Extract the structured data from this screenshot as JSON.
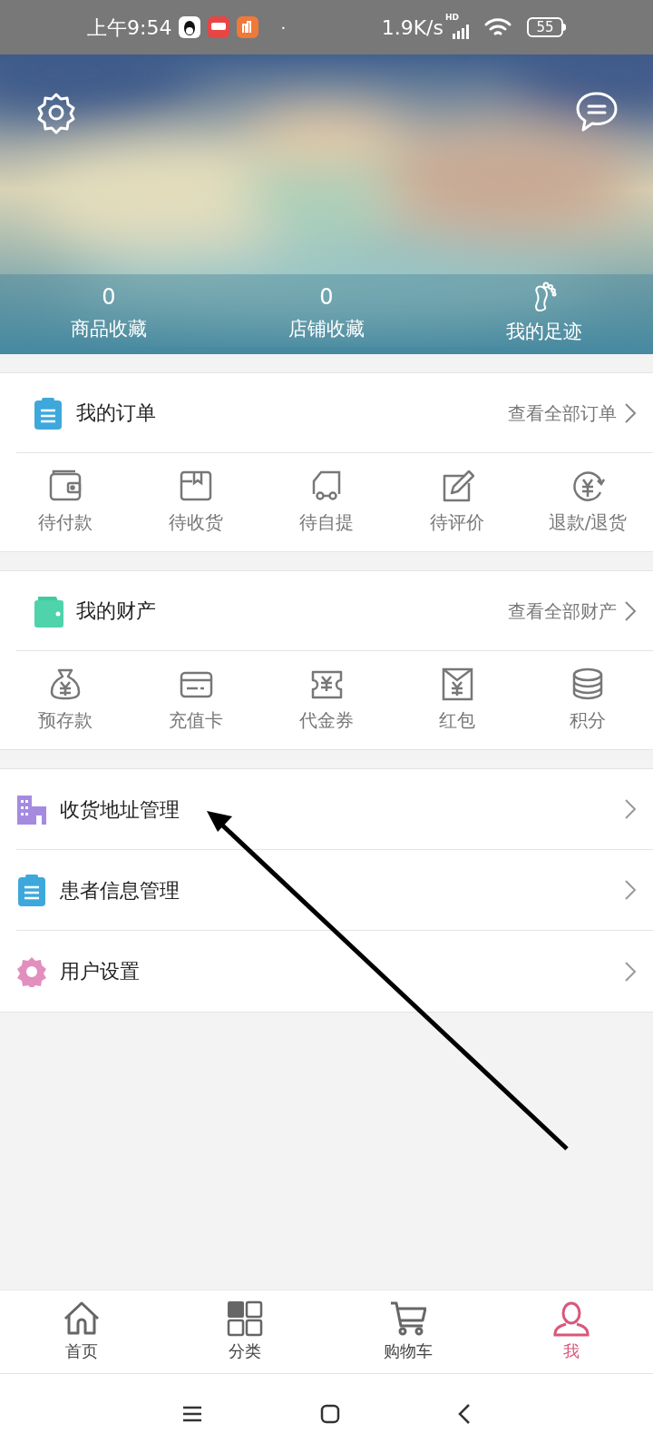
{
  "status_bar": {
    "time": "上午9:54",
    "dot": "·",
    "speed": "1.9K/s",
    "network": "HD",
    "battery": "55"
  },
  "profile": {
    "stats": [
      {
        "value": "0",
        "label": "商品收藏",
        "kind": "count"
      },
      {
        "value": "0",
        "label": "店铺收藏",
        "kind": "count"
      },
      {
        "label": "我的足迹",
        "kind": "icon"
      }
    ]
  },
  "orders": {
    "title": "我的订单",
    "link": "查看全部订单",
    "items": [
      "待付款",
      "待收货",
      "待自提",
      "待评价",
      "退款/退货"
    ]
  },
  "assets": {
    "title": "我的财产",
    "link": "查看全部财产",
    "items": [
      "预存款",
      "充值卡",
      "代金券",
      "红包",
      "积分"
    ]
  },
  "menu": [
    {
      "label": "收货地址管理",
      "color": "#a58be0"
    },
    {
      "label": "患者信息管理",
      "color": "#3ea8dc"
    },
    {
      "label": "用户设置",
      "color": "#e28fbf"
    }
  ],
  "tab_bar": [
    {
      "label": "首页",
      "selected": false
    },
    {
      "label": "分类",
      "selected": false
    },
    {
      "label": "购物车",
      "selected": false
    },
    {
      "label": "我",
      "selected": true
    }
  ]
}
